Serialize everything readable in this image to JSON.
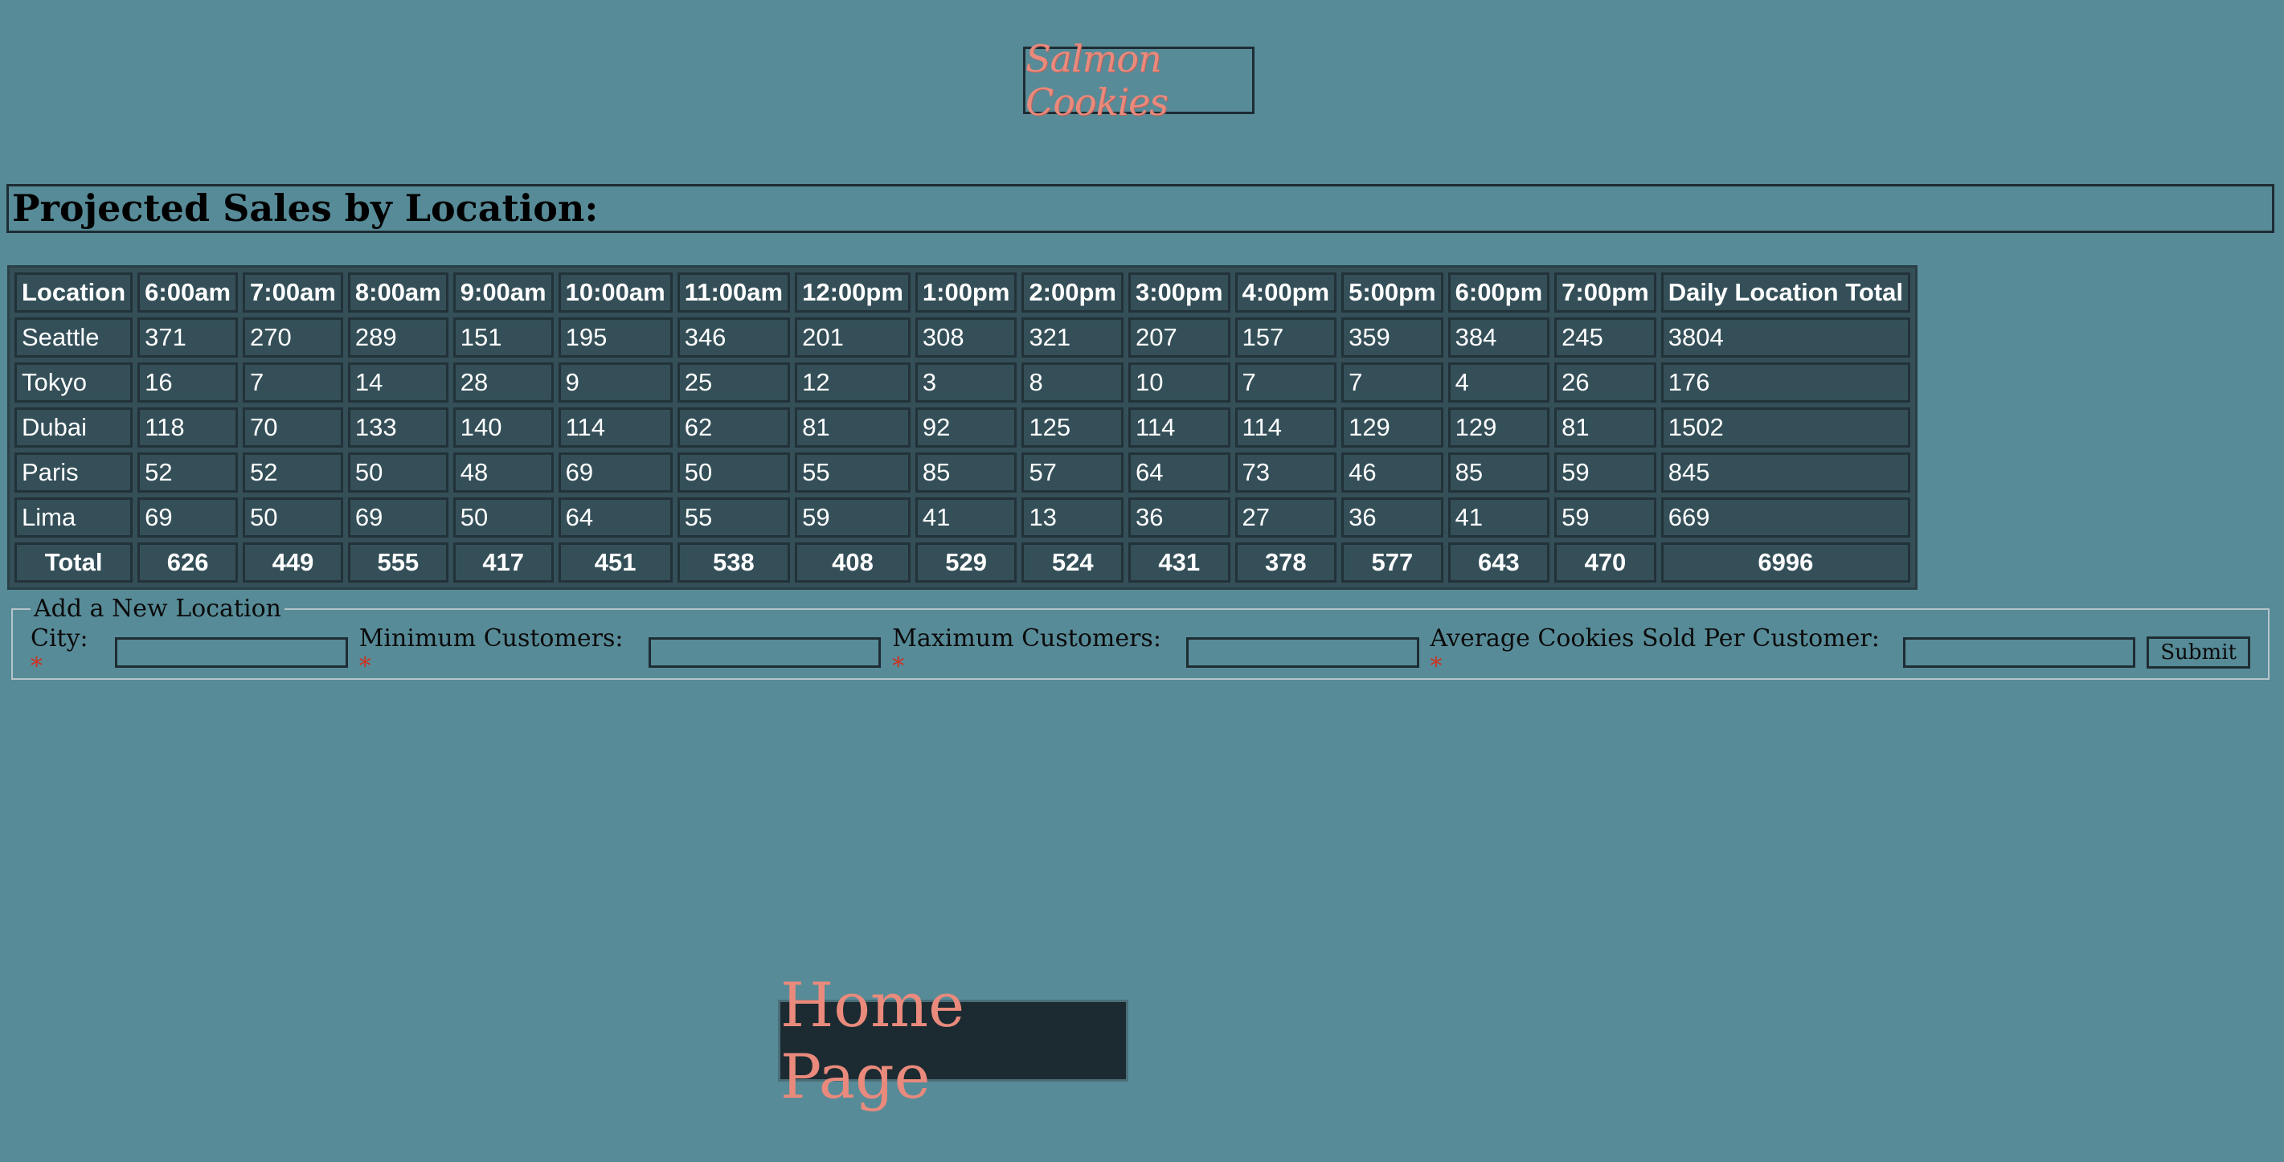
{
  "header": {
    "logo_text": "Salmon Cookies"
  },
  "page_title": "Projected Sales by Location:",
  "table": {
    "headers": [
      "Location",
      "6:00am",
      "7:00am",
      "8:00am",
      "9:00am",
      "10:00am",
      "11:00am",
      "12:00pm",
      "1:00pm",
      "2:00pm",
      "3:00pm",
      "4:00pm",
      "5:00pm",
      "6:00pm",
      "7:00pm",
      "Daily Location Total"
    ],
    "rows": [
      [
        "Seattle",
        "371",
        "270",
        "289",
        "151",
        "195",
        "346",
        "201",
        "308",
        "321",
        "207",
        "157",
        "359",
        "384",
        "245",
        "3804"
      ],
      [
        "Tokyo",
        "16",
        "7",
        "14",
        "28",
        "9",
        "25",
        "12",
        "3",
        "8",
        "10",
        "7",
        "7",
        "4",
        "26",
        "176"
      ],
      [
        "Dubai",
        "118",
        "70",
        "133",
        "140",
        "114",
        "62",
        "81",
        "92",
        "125",
        "114",
        "114",
        "129",
        "129",
        "81",
        "1502"
      ],
      [
        "Paris",
        "52",
        "52",
        "50",
        "48",
        "69",
        "50",
        "55",
        "85",
        "57",
        "64",
        "73",
        "46",
        "85",
        "59",
        "845"
      ],
      [
        "Lima",
        "69",
        "50",
        "69",
        "50",
        "64",
        "55",
        "59",
        "41",
        "13",
        "36",
        "27",
        "36",
        "41",
        "59",
        "669"
      ]
    ],
    "totals": [
      "Total",
      "626",
      "449",
      "555",
      "417",
      "451",
      "538",
      "408",
      "529",
      "524",
      "431",
      "378",
      "577",
      "643",
      "470",
      "6996"
    ]
  },
  "form": {
    "legend": "Add a New Location",
    "required_mark": "*",
    "fields": [
      {
        "label": "City:",
        "value": ""
      },
      {
        "label": "Minimum Customers:",
        "value": ""
      },
      {
        "label": "Maximum Customers:",
        "value": ""
      },
      {
        "label": "Average Cookies Sold Per Customer:",
        "value": ""
      }
    ],
    "submit_label": "Submit"
  },
  "nav": {
    "home_label": "Home Page"
  },
  "colors": {
    "background": "#578b98",
    "table_background": "#344f58",
    "accent_salmon": "#e98a7c",
    "dark": "#1c2b31"
  }
}
